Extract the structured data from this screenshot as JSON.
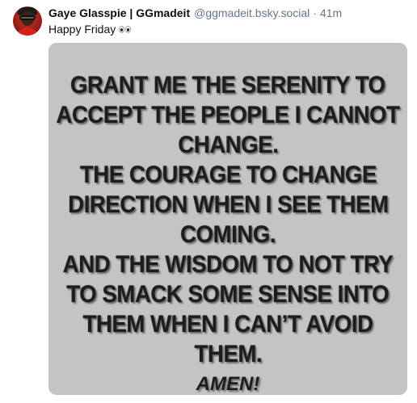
{
  "post": {
    "author_name": "Gaye Glasspie | GGmadeit",
    "handle": "@ggmadeit.bsky.social",
    "separator": "·",
    "timestamp": "41m",
    "text": "Happy Friday",
    "text_emoji": "eyes-emoji",
    "avatar_icon": "avatar-photo"
  },
  "image": {
    "background": "#c4c4c4",
    "lines": [
      "GRANT ME THE SERENITY TO",
      "ACCEPT THE PEOPLE I CANNOT",
      "CHANGE.",
      "THE COURAGE TO CHANGE",
      "DIRECTION WHEN I SEE THEM",
      "COMING.",
      "AND THE WISDOM TO NOT TRY",
      "TO SMACK SOME SENSE INTO",
      "THEM WHEN I CAN’T AVOID",
      "THEM."
    ],
    "closing": "AMEN!"
  }
}
